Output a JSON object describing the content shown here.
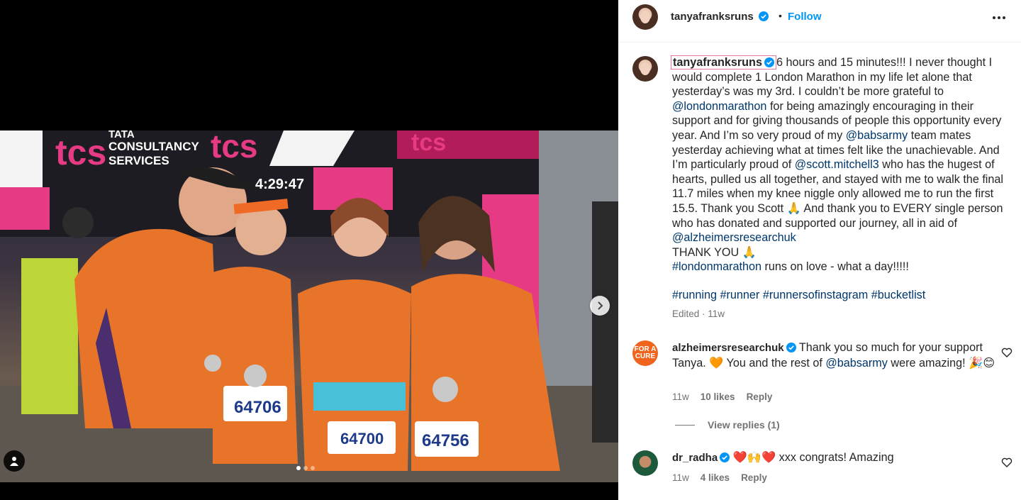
{
  "post": {
    "username": "tanyafranksruns",
    "follow_label": "Follow",
    "separator": "•",
    "media": {
      "bib_numbers": [
        "64706",
        "64700",
        "64756"
      ],
      "sign_text": [
        "tcs",
        "TATA",
        "CONSULTANCY",
        "SERVICES",
        "4:29:47"
      ],
      "carousel_current": 1,
      "carousel_total": 3
    },
    "caption": {
      "p1": "6 hours and 15 minutes!!! I never thought I would complete 1 London Marathon in my life let alone that yesterday’s was my 3rd. I couldn’t be more grateful to",
      "m1": "@londonmarathon",
      "p2": "for being amazingly encouraging in their support and for giving thousands of people this opportunity every year. And I’m so very proud of my",
      "m2": "@babsarmy",
      "p3": "team mates yesterday achieving what at times felt like the unachievable. And I’m particularly proud of",
      "m3": "@scott.mitchell3",
      "p4": "who has the hugest of hearts, pulled us all together, and stayed with me to walk the final 11.7 miles when my knee niggle only allowed me to run the first 15.5. Thank you Scott 🙏 And thank you to EVERY single person who has donated and supported our journey, all in aid of",
      "m4": "@alzheimersresearchuk",
      "p5": "THANK YOU 🙏",
      "h1": "#londonmarathon",
      "p6": "runs on love - what a day!!!!!"
    },
    "hashtags": [
      "#running",
      "#runner",
      "#runnersofinstagram",
      "#bucketlist"
    ],
    "edited": "Edited · 11w"
  },
  "comments": [
    {
      "username": "alzheimersresearchuk",
      "avatar_text": [
        "FOR A",
        "CURE"
      ],
      "text_a": "Thank you so much for your support Tanya. 🧡 You and the rest of",
      "mention": "@babsarmy",
      "text_b": "were amazing! 🎉😊",
      "time": "11w",
      "likes": "10 likes",
      "reply": "Reply",
      "view_replies": "View replies (1)"
    },
    {
      "username": "dr_radha",
      "text": "❤️🙌❤️ xxx congrats! Amazing",
      "time": "11w",
      "likes": "4 likes",
      "reply": "Reply"
    }
  ],
  "colors": {
    "accent": "#0095f6",
    "mention": "#00376b",
    "meta": "#737373",
    "highlight_border": "#e8799a"
  }
}
